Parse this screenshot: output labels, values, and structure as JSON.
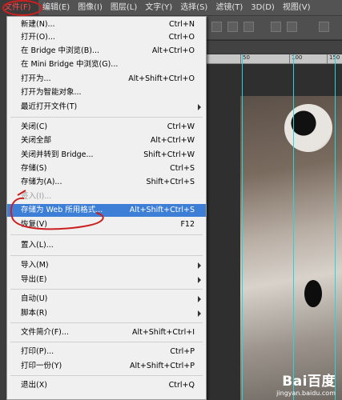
{
  "menubar": [
    {
      "label": "文件(F)",
      "active": true
    },
    {
      "label": "编辑(E)"
    },
    {
      "label": "图像(I)"
    },
    {
      "label": "图层(L)"
    },
    {
      "label": "文字(Y)"
    },
    {
      "label": "选择(S)"
    },
    {
      "label": "滤镜(T)"
    },
    {
      "label": "3D(D)"
    },
    {
      "label": "视图(V)"
    }
  ],
  "ruler": {
    "labels": [
      "50",
      "100",
      "150"
    ]
  },
  "file_menu": {
    "items": [
      {
        "label": "新建(N)...",
        "shortcut": "Ctrl+N"
      },
      {
        "label": "打开(O)...",
        "shortcut": "Ctrl+O"
      },
      {
        "label": "在 Bridge 中浏览(B)...",
        "shortcut": "Alt+Ctrl+O"
      },
      {
        "label": "在 Mini Bridge 中浏览(G)...",
        "shortcut": ""
      },
      {
        "label": "打开为...",
        "shortcut": "Alt+Shift+Ctrl+O"
      },
      {
        "label": "打开为智能对象...",
        "shortcut": ""
      },
      {
        "label": "最近打开文件(T)",
        "shortcut": "",
        "submenu": true
      },
      {
        "label": "关闭(C)",
        "shortcut": "Ctrl+W"
      },
      {
        "label": "关闭全部",
        "shortcut": "Alt+Ctrl+W"
      },
      {
        "label": "关闭并转到 Bridge...",
        "shortcut": "Shift+Ctrl+W"
      },
      {
        "label": "存储(S)",
        "shortcut": "Ctrl+S"
      },
      {
        "label": "存储为(A)...",
        "shortcut": "Shift+Ctrl+S"
      },
      {
        "label": "签入(I)...",
        "shortcut": "",
        "disabled": true
      },
      {
        "label": "存储为 Web 所用格式...",
        "shortcut": "Alt+Shift+Ctrl+S",
        "highlighted": true
      },
      {
        "label": "恢复(V)",
        "shortcut": "F12"
      },
      {
        "label": "置入(L)...",
        "shortcut": ""
      },
      {
        "label": "导入(M)",
        "shortcut": "",
        "submenu": true
      },
      {
        "label": "导出(E)",
        "shortcut": "",
        "submenu": true
      },
      {
        "label": "自动(U)",
        "shortcut": "",
        "submenu": true
      },
      {
        "label": "脚本(R)",
        "shortcut": "",
        "submenu": true
      },
      {
        "label": "文件简介(F)...",
        "shortcut": "Alt+Shift+Ctrl+I"
      },
      {
        "label": "打印(P)...",
        "shortcut": "Ctrl+P"
      },
      {
        "label": "打印一份(Y)",
        "shortcut": "Alt+Shift+Ctrl+P"
      },
      {
        "label": "退出(X)",
        "shortcut": "Ctrl+Q"
      }
    ]
  },
  "watermark": {
    "logo": "Bai百度",
    "url": "jingyan.baidu.com"
  },
  "colors": {
    "highlight": "#3d7fd6",
    "annotation": "#cc1f1f",
    "guide": "#23d8d8"
  }
}
